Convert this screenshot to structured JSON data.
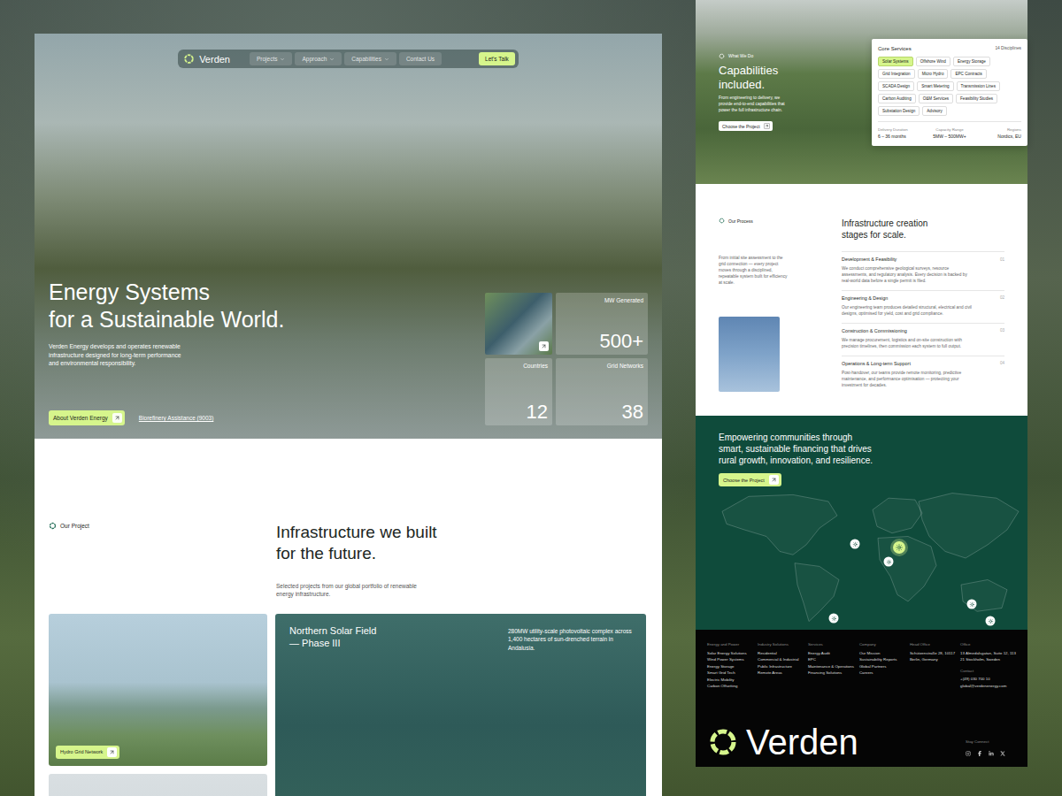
{
  "nav": {
    "brand": "Verden",
    "items": [
      {
        "label": "Projects",
        "dropdown": true
      },
      {
        "label": "Approach",
        "dropdown": true
      },
      {
        "label": "Capabilities",
        "dropdown": true
      },
      {
        "label": "Contact Us",
        "dropdown": false
      }
    ],
    "cta": "Let's Talk"
  },
  "hero": {
    "title_lines": [
      "Energy Systems",
      "for a Sustainable World."
    ],
    "description": "Verden Energy develops and operates renewable infrastructure designed for long-term performance and environmental responsibility.",
    "primary_button": "About Verden Energy",
    "link": "Biorefinery Assistance (9003)",
    "stats": [
      {
        "label": "MW Generated",
        "value": "500+"
      },
      {
        "label": "Countries",
        "value": "12"
      },
      {
        "label": "Grid Networks",
        "value": "38"
      }
    ]
  },
  "projects": {
    "eyebrow": "Our Project",
    "title_lines": [
      "Infrastructure we built",
      "for the future."
    ],
    "subtitle": "Selected projects from our global portfolio of renewable energy infrastructure.",
    "cards": [
      {
        "badge": "Hydro Grid Network"
      }
    ],
    "featured": {
      "title_lines": [
        "Northern Solar Field",
        "— Phase III"
      ],
      "description": "280MW utility-scale photovoltaic complex across 1,400 hectares of sun-drenched terrain in Andalusia."
    }
  },
  "capabilities": {
    "eyebrow": "What We Do",
    "title_lines": [
      "Capabilities",
      "included."
    ],
    "description": "From engineering to delivery, we provide end-to-end capabilities that power the full infrastructure chain.",
    "button": "Choose the Project",
    "card_title": "Core Services",
    "card_count": "14 Disciplines",
    "chips": [
      {
        "label": "Solar Systems",
        "selected": true
      },
      {
        "label": "Offshore Wind",
        "selected": false
      },
      {
        "label": "Energy Storage",
        "selected": false
      },
      {
        "label": "Grid Integration",
        "selected": false
      },
      {
        "label": "Micro Hydro",
        "selected": false
      },
      {
        "label": "EPC Contracts",
        "selected": false
      },
      {
        "label": "SCADA Design",
        "selected": false
      },
      {
        "label": "Smart Metering",
        "selected": false
      },
      {
        "label": "Transmission Lines",
        "selected": false
      },
      {
        "label": "Carbon Auditing",
        "selected": false
      },
      {
        "label": "O&M Services",
        "selected": false
      },
      {
        "label": "Feasibility Studies",
        "selected": false
      },
      {
        "label": "Substation Design",
        "selected": false
      },
      {
        "label": "Advisory",
        "selected": false
      }
    ],
    "stats": [
      {
        "label": "Delivery Duration",
        "value": "6 – 36 months"
      },
      {
        "label": "Capacity Range",
        "value": "5MW – 500MW+"
      },
      {
        "label": "Regions",
        "value": "Nordics, EU"
      }
    ]
  },
  "process": {
    "eyebrow": "Our Process",
    "title_lines": [
      "Infrastructure creation",
      "stages for scale."
    ],
    "description": "From initial site assessment to the grid connection — every project moves through a disciplined, repeatable system built for efficiency at scale.",
    "steps": [
      {
        "title": "Development & Feasibility",
        "number": "01",
        "description": "We conduct comprehensive geological surveys, resource assessments, and regulatory analysis. Every decision is backed by real-world data before a single permit is filed."
      },
      {
        "title": "Engineering & Design",
        "number": "02",
        "description": "Our engineering team produces detailed structural, electrical and civil designs, optimised for yield, cost and grid compliance."
      },
      {
        "title": "Construction & Commissioning",
        "number": "03",
        "description": "We manage procurement, logistics and on-site construction with precision timelines, then commission each system to full output."
      },
      {
        "title": "Operations & Long-term Support",
        "number": "04",
        "description": "Post-handover, our teams provide remote monitoring, predictive maintenance, and performance optimisation — protecting your investment for decades."
      }
    ]
  },
  "community": {
    "title": "Empowering communities through smart, sustainable financing that drives rural growth, innovation, and resilience.",
    "button": "Choose the Project",
    "pins": [
      {
        "selected": false
      },
      {
        "selected": true
      },
      {
        "selected": false
      },
      {
        "selected": false
      },
      {
        "selected": false
      },
      {
        "selected": false
      }
    ]
  },
  "footer": {
    "columns": [
      {
        "title": "Energy and Power",
        "links": [
          "Solar Energy Solutions",
          "Wind Power Systems",
          "Energy Storage",
          "Smart Grid Tech",
          "Electric Mobility",
          "Carbon Offsetting"
        ]
      },
      {
        "title": "Industry Solutions",
        "links": [
          "Residential",
          "Commercial & Industrial",
          "Public Infrastructure",
          "Remote Areas"
        ]
      },
      {
        "title": "Services",
        "links": [
          "Energy Audit",
          "EPC",
          "Maintenance & Operations",
          "Financing Solutions"
        ]
      },
      {
        "title": "Company",
        "links": [
          "Our Mission",
          "Sustainability Reports",
          "Global Partners",
          "Careers"
        ]
      },
      {
        "title": "Head Office",
        "links": [
          "Schützenstraße 28, 10117",
          "Berlin, Germany"
        ]
      },
      {
        "title": "Office",
        "links": [
          "13 Almedalsgatan, Suite 12, 113",
          "21 Stockholm, Sweden"
        ]
      }
    ],
    "contact": {
      "title": "Contact",
      "links": [
        "+(49) 030 700 10",
        "global@verdenenergy.com"
      ]
    },
    "brand": "Verden",
    "social_title": "Stay Connect"
  }
}
